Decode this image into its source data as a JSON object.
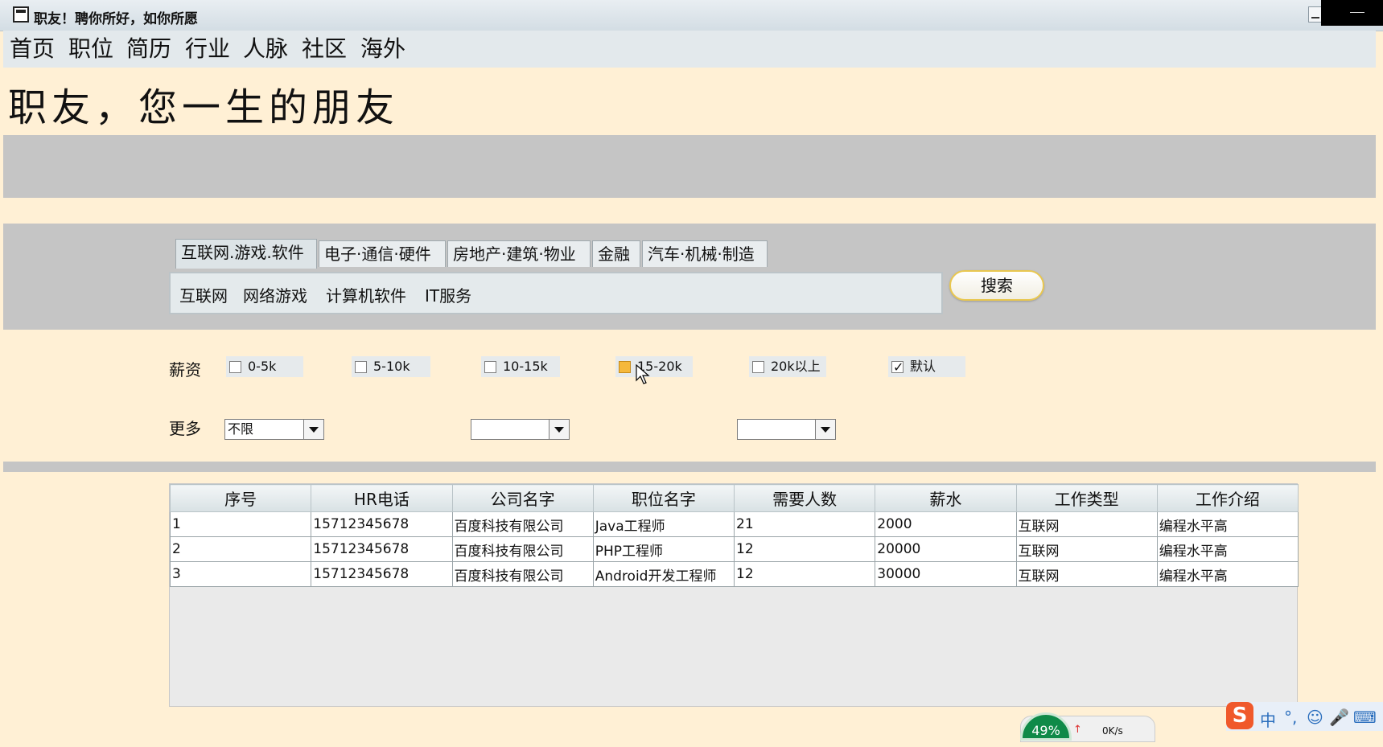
{
  "window": {
    "title": "职友！聘你所好，如你所愿"
  },
  "menu": [
    "首页",
    "职位",
    "简历",
    "行业",
    "人脉",
    "社区",
    "海外"
  ],
  "banner": "职友，您一生的朋友",
  "tabs": [
    {
      "label": "互联网.游戏.软件",
      "active": true
    },
    {
      "label": "电子·通信·硬件"
    },
    {
      "label": "房地产·建筑·物业"
    },
    {
      "label": "金融"
    },
    {
      "label": "汽车·机械·制造"
    }
  ],
  "subcategories": [
    "互联网",
    "网络游戏",
    "计算机软件",
    "IT服务"
  ],
  "search_label": "搜索",
  "salary": {
    "label": "薪资",
    "options": [
      {
        "label": "0-5k",
        "checked": false
      },
      {
        "label": "5-10k",
        "checked": false
      },
      {
        "label": "10-15k",
        "checked": false
      },
      {
        "label": "15-20k",
        "checked": false,
        "hover": true
      },
      {
        "label": "20k以上",
        "checked": false
      },
      {
        "label": "默认",
        "checked": true
      }
    ]
  },
  "more": {
    "label": "更多",
    "combos": [
      {
        "value": "不限"
      },
      {
        "value": ""
      },
      {
        "value": ""
      }
    ]
  },
  "table": {
    "headers": [
      "序号",
      "HR电话",
      "公司名字",
      "职位名字",
      "需要人数",
      "薪水",
      "工作类型",
      "工作介绍"
    ],
    "rows": [
      [
        "1",
        "15712345678",
        "百度科技有限公司",
        "Java工程师",
        "21",
        "2000",
        "互联网",
        "编程水平高"
      ],
      [
        "2",
        "15712345678",
        "百度科技有限公司",
        "PHP工程师",
        "12",
        "20000",
        "互联网",
        "编程水平高"
      ],
      [
        "3",
        "15712345678",
        "百度科技有限公司",
        "Android开发工程师",
        "12",
        "30000",
        "互联网",
        "编程水平高"
      ]
    ]
  },
  "taskbar": {
    "cpu_percent": "49%",
    "net_speed": "0K/s",
    "ime": [
      "中",
      "°,",
      "☺",
      "🎤",
      "⌨"
    ]
  },
  "colors": {
    "background": "#fff0d5",
    "panel": "#c5c5c5",
    "accent": "#e9c74f"
  }
}
